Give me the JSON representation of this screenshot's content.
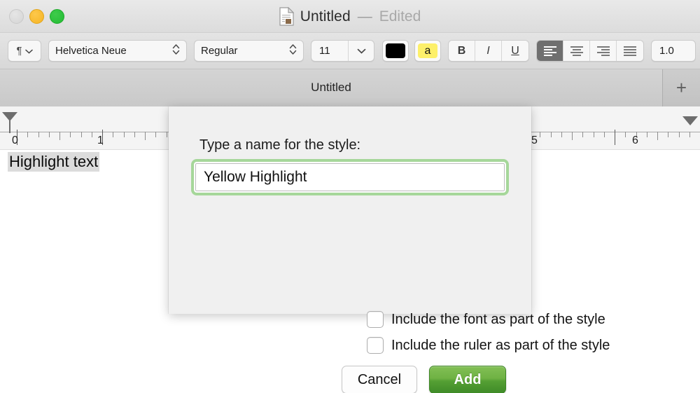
{
  "window": {
    "title": "Untitled",
    "separator": "—",
    "edited_label": "Edited",
    "doc_icon": "document-icon",
    "traffic_lights": [
      {
        "name": "close-button",
        "label": "Close",
        "color": "#d4d4d4"
      },
      {
        "name": "minimize-button",
        "label": "Minimize",
        "color": "#f6b424"
      },
      {
        "name": "zoom-button",
        "label": "Zoom",
        "color": "#23bc33"
      }
    ]
  },
  "toolbar": {
    "paragraph_style_icon": "pilcrow-icon",
    "paragraph_style_chevron": "chevron-down-icon",
    "font_family": "Helvetica Neue",
    "font_family_stepper": "stepper-icon",
    "font_style": "Regular",
    "font_style_stepper": "stepper-icon",
    "font_size": "11",
    "font_size_chevron": "chevron-down-icon",
    "text_color_swatch": "#000000",
    "highlight_color_swatch": "#fdf06a",
    "highlight_glyph": "a",
    "bold_label": "B",
    "italic_label": "I",
    "underline_label": "U",
    "alignments": [
      {
        "name": "align-left",
        "selected": true
      },
      {
        "name": "align-center",
        "selected": false
      },
      {
        "name": "align-right",
        "selected": false
      },
      {
        "name": "align-justify",
        "selected": false
      }
    ],
    "line_spacing": "1.0"
  },
  "tabbar": {
    "tabs": [
      {
        "label": "Untitled",
        "active": true
      }
    ],
    "new_tab_label": "+"
  },
  "ruler": {
    "numbers": [
      "0",
      "1",
      "5",
      "6"
    ],
    "left_indent_marker": "indent-marker",
    "right_indent_marker": "indent-marker"
  },
  "document": {
    "text": "Highlight text",
    "selection_color": "#dcdcdc"
  },
  "sheet": {
    "prompt": "Type a name for the style:",
    "style_name_value": "Yellow Highlight",
    "style_name_placeholder": "Style name",
    "focus_ring_color": "#a6d79a",
    "checkboxes": [
      {
        "label": "Include the font as part of the style",
        "checked": false
      },
      {
        "label": "Include the ruler as part of the style",
        "checked": false
      }
    ],
    "cancel_label": "Cancel",
    "add_label": "Add",
    "add_button_color": "#55a034"
  }
}
